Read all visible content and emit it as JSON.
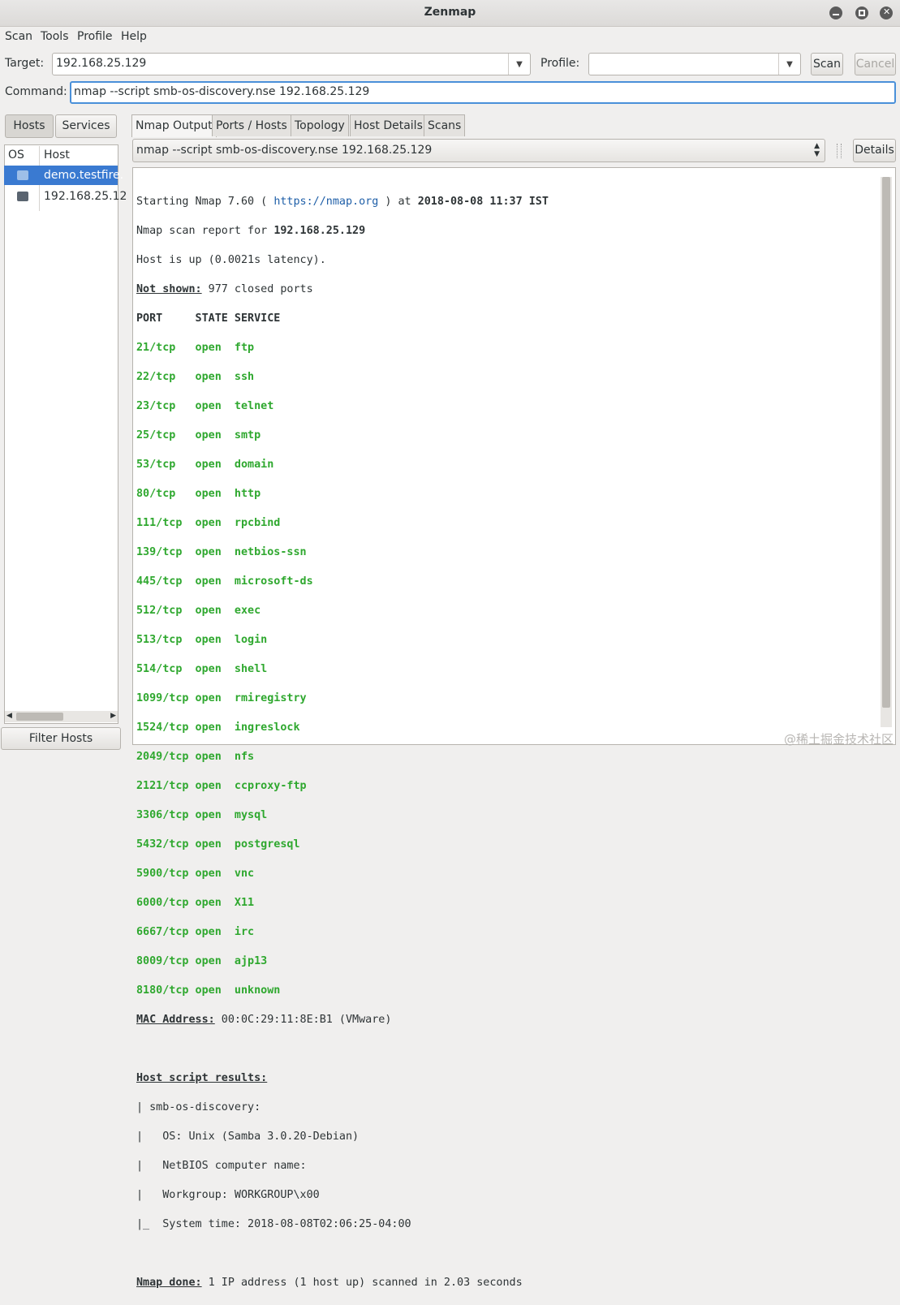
{
  "window": {
    "title": "Zenmap"
  },
  "menu": [
    "Scan",
    "Tools",
    "Profile",
    "Help"
  ],
  "target": {
    "label": "Target:",
    "value": "192.168.25.129"
  },
  "profile": {
    "label": "Profile:",
    "value": ""
  },
  "buttons": {
    "scan": "Scan",
    "cancel": "Cancel",
    "details": "Details",
    "filter_hosts": "Filter Hosts"
  },
  "command": {
    "label": "Command:",
    "value": "nmap --script smb-os-discovery.nse 192.168.25.129"
  },
  "left": {
    "toggle_hosts": "Hosts",
    "toggle_services": "Services",
    "col_os": "OS",
    "col_host": "Host",
    "hosts": [
      "demo.testfire.",
      "192.168.25.12"
    ]
  },
  "tabs": [
    "Nmap Output",
    "Ports / Hosts",
    "Topology",
    "Host Details",
    "Scans"
  ],
  "scan_select": "nmap --script smb-os-discovery.nse 192.168.25.129",
  "output": {
    "start_prefix": "Starting Nmap 7.60 ( ",
    "start_link": "https://nmap.org",
    "start_mid": " ) at ",
    "start_time": "2018-08-08 11:37 IST",
    "report_prefix": "Nmap scan report for ",
    "report_host": "192.168.25.129",
    "host_up": "Host is up (0.0021s latency).",
    "not_shown_label": "Not shown:",
    "not_shown_value": " 977 closed ports",
    "header": "PORT     STATE SERVICE",
    "ports": [
      "21/tcp   open  ftp",
      "22/tcp   open  ssh",
      "23/tcp   open  telnet",
      "25/tcp   open  smtp",
      "53/tcp   open  domain",
      "80/tcp   open  http",
      "111/tcp  open  rpcbind",
      "139/tcp  open  netbios-ssn",
      "445/tcp  open  microsoft-ds",
      "512/tcp  open  exec",
      "513/tcp  open  login",
      "514/tcp  open  shell",
      "1099/tcp open  rmiregistry",
      "1524/tcp open  ingreslock",
      "2049/tcp open  nfs",
      "2121/tcp open  ccproxy-ftp",
      "3306/tcp open  mysql",
      "5432/tcp open  postgresql",
      "5900/tcp open  vnc",
      "6000/tcp open  X11",
      "6667/tcp open  irc",
      "8009/tcp open  ajp13",
      "8180/tcp open  unknown"
    ],
    "mac_label": "MAC Address:",
    "mac_value": " 00:0C:29:11:8E:B1 (VMware)",
    "script_label": "Host script results:",
    "script_lines": [
      "| smb-os-discovery:",
      "|   OS: Unix (Samba 3.0.20-Debian)",
      "|   NetBIOS computer name:",
      "|   Workgroup: WORKGROUP\\x00",
      "|_  System time: 2018-08-08T02:06:25-04:00"
    ],
    "done_label": "Nmap done:",
    "done_value": " 1 IP address (1 host up) scanned in 2.03 seconds"
  },
  "watermark": "@稀土掘金技术社区",
  "colors": {
    "selection": "#3a7ad1",
    "open_port": "#2fa82f",
    "link": "#1f5fa8"
  }
}
